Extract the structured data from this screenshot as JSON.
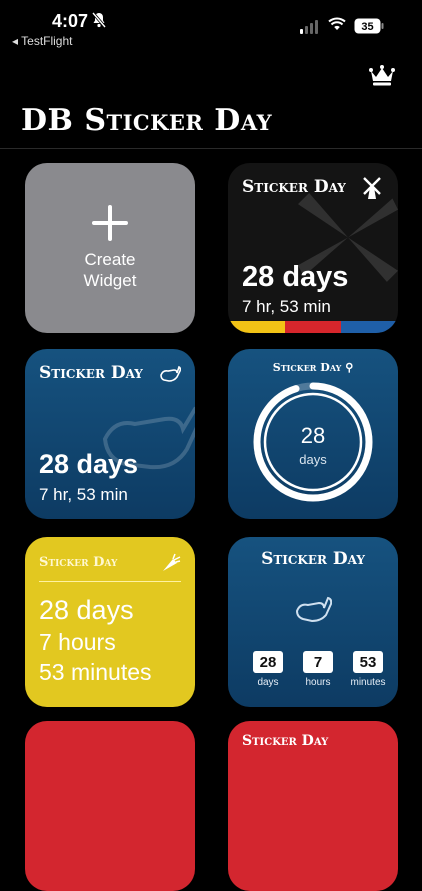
{
  "status_bar": {
    "time": "4:07",
    "back_label": "◂ TestFlight",
    "battery": "35"
  },
  "app": {
    "title": "DB Sticker Day"
  },
  "widgets": {
    "create": {
      "label_line1": "Create",
      "label_line2": "Widget"
    },
    "dark": {
      "brand": "Sticker Day",
      "days": "28 days",
      "sub": "7 hr, 53 min",
      "stripe_colors": [
        "#f2c316",
        "#d6262c",
        "#1f5fa8"
      ]
    },
    "blue": {
      "brand": "Sticker Day",
      "days": "28 days",
      "sub": "7 hr, 53 min"
    },
    "ring": {
      "brand": "Sticker Day",
      "number": "28",
      "unit": "days",
      "progress_fraction": 0.95
    },
    "yellow": {
      "brand": "Sticker Day",
      "line1": "28 days",
      "line2": "7 hours",
      "line3": "53 minutes"
    },
    "countdown": {
      "brand": "Sticker Day",
      "cells": [
        {
          "value": "28",
          "label": "days"
        },
        {
          "value": "7",
          "label": "hours"
        },
        {
          "value": "53",
          "label": "minutes"
        }
      ]
    },
    "bottom_right": {
      "brand": "Sticker Day"
    }
  },
  "colors": {
    "background": "#000000",
    "create_tile": "#8a8a8e",
    "blue_tile": "#0d3b63",
    "yellow_tile": "#e2c820",
    "red_tile": "#d3262f"
  }
}
